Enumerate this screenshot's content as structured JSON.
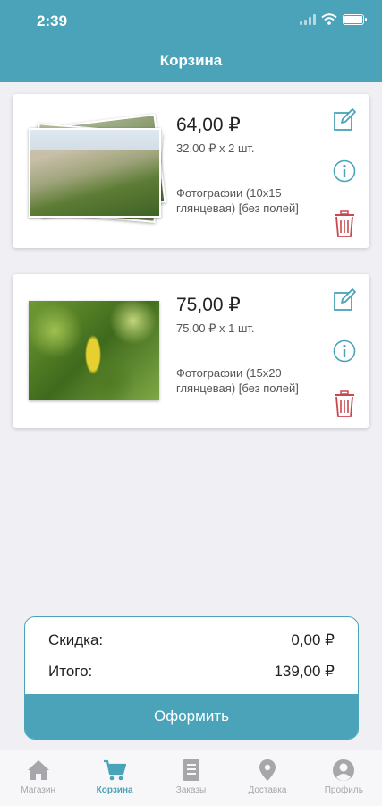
{
  "status_bar": {
    "time": "2:39"
  },
  "header": {
    "title": "Корзина"
  },
  "cart": {
    "items": [
      {
        "price": "64,00 ₽",
        "unit": "32,00 ₽ x 2 шт.",
        "description": "Фотографии (10x15 глянцевая) [без полей]",
        "photo": "coastal-hills-photo-stack"
      },
      {
        "price": "75,00 ₽",
        "unit": "75,00 ₽ x 1 шт.",
        "description": "Фотографии (15x20 глянцевая) [без полей]",
        "photo": "lemon-tree-photo"
      }
    ],
    "icons": {
      "edit": "edit-icon",
      "info": "info-icon",
      "delete": "trash-icon"
    }
  },
  "summary": {
    "discount_label": "Скидка:",
    "discount_value": "0,00 ₽",
    "total_label": "Итого:",
    "total_value": "139,00 ₽",
    "checkout_label": "Оформить"
  },
  "tabs": [
    {
      "label": "Магазин",
      "icon": "home-icon",
      "active": false
    },
    {
      "label": "Корзина",
      "icon": "cart-icon",
      "active": true
    },
    {
      "label": "Заказы",
      "icon": "orders-icon",
      "active": false
    },
    {
      "label": "Доставка",
      "icon": "location-pin-icon",
      "active": false
    },
    {
      "label": "Профиль",
      "icon": "profile-icon",
      "active": false
    }
  ],
  "colors": {
    "accent": "#4aa3b9",
    "delete": "#c9484d",
    "background": "#efeff4",
    "tab_inactive": "#a6a6ab"
  }
}
